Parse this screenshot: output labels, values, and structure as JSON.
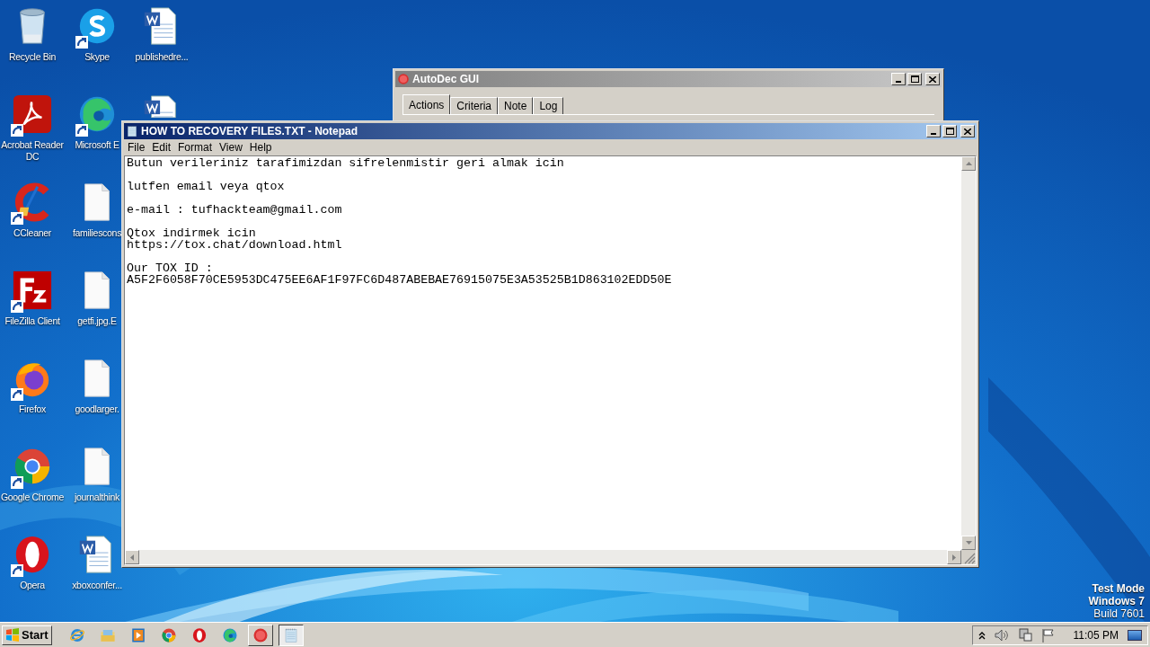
{
  "desktop": {
    "columns": [
      [
        {
          "label": "Recycle Bin",
          "kind": "recycle",
          "shortcut": false
        },
        {
          "label": "Acrobat Reader DC",
          "kind": "acrobat",
          "shortcut": true
        },
        {
          "label": "CCleaner",
          "kind": "ccleaner",
          "shortcut": true
        },
        {
          "label": "FileZilla Client",
          "kind": "filezilla",
          "shortcut": true
        },
        {
          "label": "Firefox",
          "kind": "firefox",
          "shortcut": true
        },
        {
          "label": "Google Chrome",
          "kind": "chrome",
          "shortcut": true
        },
        {
          "label": "Opera",
          "kind": "opera",
          "shortcut": true
        }
      ],
      [
        {
          "label": "Skype",
          "kind": "skype",
          "shortcut": true
        },
        {
          "label": "Microsoft E",
          "kind": "edge",
          "shortcut": true
        },
        {
          "label": "familiescons",
          "kind": "file",
          "shortcut": false
        },
        {
          "label": "getfi.jpg.E",
          "kind": "file",
          "shortcut": false
        },
        {
          "label": "goodlarger.",
          "kind": "file",
          "shortcut": false
        },
        {
          "label": "journalthink",
          "kind": "file",
          "shortcut": false
        },
        {
          "label": "xboxconfer...",
          "kind": "word",
          "shortcut": false
        }
      ],
      [
        {
          "label": "publishedre...",
          "kind": "word",
          "shortcut": false
        },
        {
          "kind": "word"
        }
      ]
    ],
    "notice": [
      "Test Mode",
      "Windows 7",
      "Build 7601"
    ]
  },
  "autodec": {
    "title": "AutoDec GUI",
    "tabs": [
      {
        "label": "Actions",
        "selected": true
      },
      {
        "label": "Criteria",
        "selected": false
      },
      {
        "label": "Note",
        "selected": false
      },
      {
        "label": "Log",
        "selected": false
      }
    ]
  },
  "notepad": {
    "title": "HOW TO RECOVERY FILES.TXT - Notepad",
    "menu": [
      "File",
      "Edit",
      "Format",
      "View",
      "Help"
    ],
    "paragraphs": [
      [
        "Butun verileriniz tarafimizdan sifrelenmistir geri almak icin"
      ],
      [
        "lutfen email veya qtox"
      ],
      [
        "e-mail : tufhackteam@gmail.com"
      ],
      [
        "Qtox indirmek icin",
        "https://tox.chat/download.html"
      ],
      [
        "Our TOX ID :",
        "A5F2F6058F70CE5953DC475EE6AF1F97FC6D487ABEBAE76915075E3A53525B1D863102EDD50E"
      ]
    ]
  },
  "taskbar": {
    "start": "Start",
    "apps": [
      {
        "kind": "ie",
        "selected": false
      },
      {
        "kind": "explorer",
        "selected": false
      },
      {
        "kind": "media",
        "selected": false
      },
      {
        "kind": "chrome",
        "selected": false
      },
      {
        "kind": "opera",
        "selected": false
      },
      {
        "kind": "edge",
        "selected": false
      },
      {
        "kind": "autodec",
        "selected": false
      },
      {
        "kind": "notepad",
        "selected": true
      }
    ],
    "time": "11:05 PM"
  }
}
